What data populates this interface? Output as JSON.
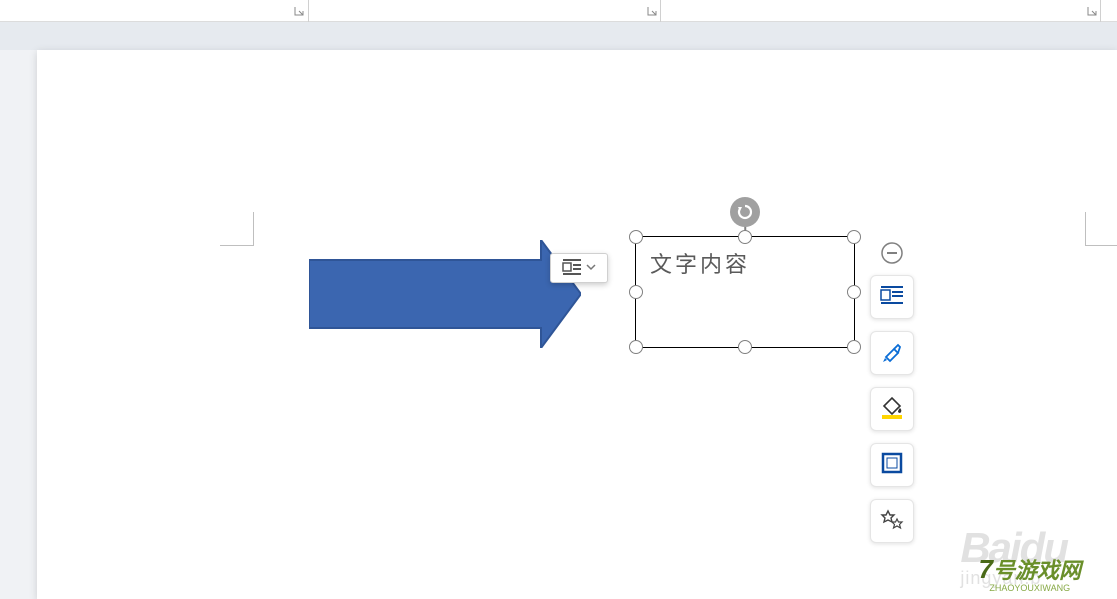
{
  "textbox": {
    "content": "文字内容"
  },
  "shapes": {
    "arrow_color": "#3b66b0",
    "arrow_stroke": "#2f5597"
  },
  "floating_toolbar": {
    "collapse_icon": "minus-icon",
    "layout_icon": "text-wrap-icon",
    "brush_icon": "format-painter-icon",
    "fill_icon": "fill-bucket-icon",
    "outline_icon": "outline-icon",
    "effects_icon": "effects-icon"
  },
  "popup": {
    "layout_icon": "text-wrap-icon",
    "dropdown_icon": "chevron-down-icon"
  },
  "watermarks": {
    "baidu_main": "Baidu",
    "baidu_sub": "jingyan.b",
    "site_num": "7",
    "site_cn": "号游戏网",
    "site_en": "ZHAOYOUXIWANG"
  }
}
